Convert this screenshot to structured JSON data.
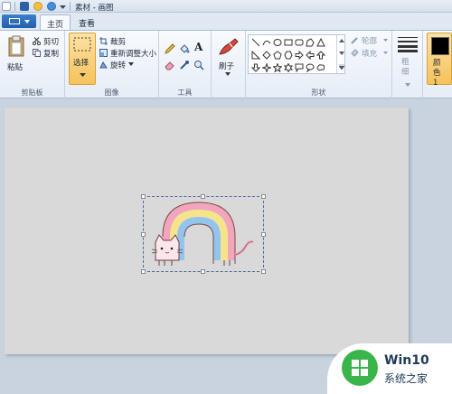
{
  "window": {
    "title": "素材 - 画图"
  },
  "tabs": [
    {
      "label": "主页",
      "active": true
    },
    {
      "label": "查看",
      "active": false
    }
  ],
  "ribbon": {
    "clipboard": {
      "group_label": "剪贴板",
      "paste_label": "粘贴",
      "cut_label": "剪切",
      "copy_label": "复制"
    },
    "image": {
      "group_label": "图像",
      "select_label": "选择",
      "crop_label": "裁剪",
      "resize_label": "重新调整大小",
      "rotate_label": "旋转"
    },
    "tools": {
      "group_label": "工具"
    },
    "brushes": {
      "label": "刷子"
    },
    "shapes": {
      "group_label": "形状",
      "outline_label": "轮廓",
      "fill_label": "填充"
    },
    "size": {
      "label": "粗细"
    },
    "color": {
      "label": "颜色 1"
    }
  },
  "watermark": {
    "brand": "Win10",
    "site": "系统之家"
  },
  "colors": {
    "accent_active": "#f6c25b",
    "rainbow_pink": "#f3a6bb",
    "rainbow_yellow": "#f6e48a",
    "rainbow_blue": "#93c4ee",
    "watermark_green": "#39b54a"
  }
}
